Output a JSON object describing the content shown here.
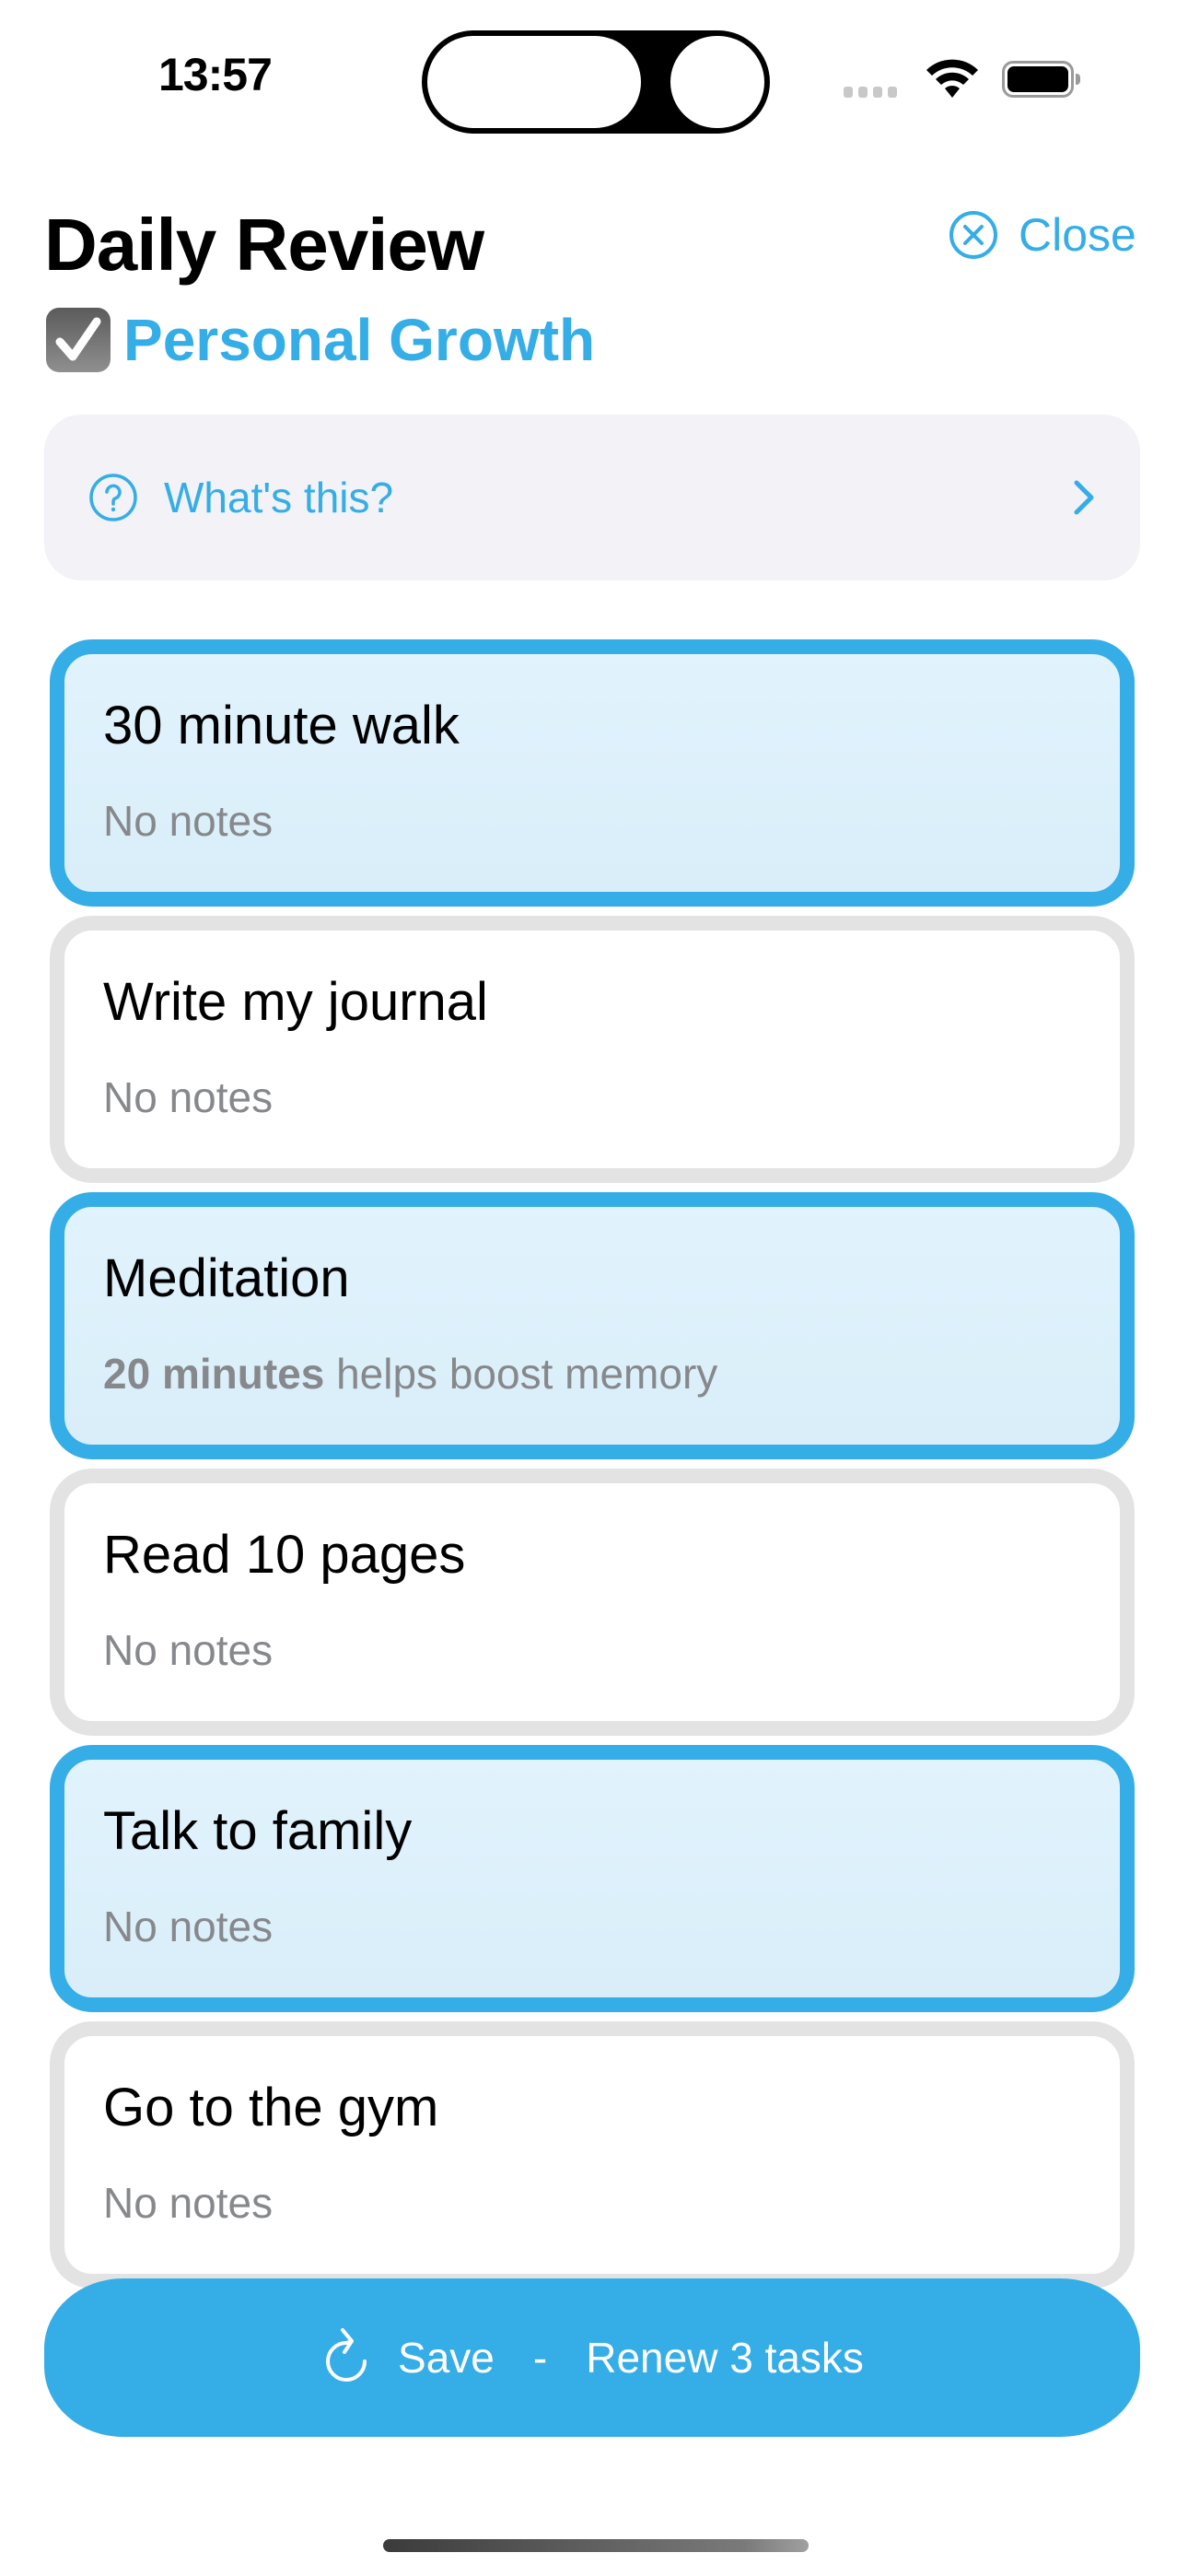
{
  "status_bar": {
    "time": "13:57",
    "icons": [
      "cellular-signal-icon",
      "wifi-icon",
      "battery-icon"
    ]
  },
  "header": {
    "title": "Daily Review",
    "close_label": "Close",
    "close_icon": "xmark-circle-icon",
    "category": {
      "icon": "checkbox-checked-icon",
      "label": "Personal Growth"
    }
  },
  "info_row": {
    "icon": "question-circle-icon",
    "label": "What's this?",
    "trailing_icon": "chevron-right-icon"
  },
  "tasks": [
    {
      "title": "30 minute walk",
      "note": "No notes",
      "note_bold": "",
      "selected": true
    },
    {
      "title": "Write my journal",
      "note": "No notes",
      "note_bold": "",
      "selected": false
    },
    {
      "title": "Meditation",
      "note": " helps boost memory",
      "note_bold": "20 minutes",
      "selected": true
    },
    {
      "title": "Read 10 pages",
      "note": "No notes",
      "note_bold": "",
      "selected": false
    },
    {
      "title": "Talk to family",
      "note": "No notes",
      "note_bold": "",
      "selected": true
    },
    {
      "title": "Go to the gym",
      "note": "No notes",
      "note_bold": "",
      "selected": false
    }
  ],
  "save_button": {
    "icon": "arrow-clockwise-icon",
    "label": "Save",
    "separator": "-",
    "detail": "Renew 3 tasks"
  },
  "colors": {
    "accent": "#35ade6",
    "selected_card_bg": "#dff2fc",
    "unselected_border": "#e3e3e3",
    "info_bg": "#f2f2f7",
    "note_text": "#86888c"
  }
}
